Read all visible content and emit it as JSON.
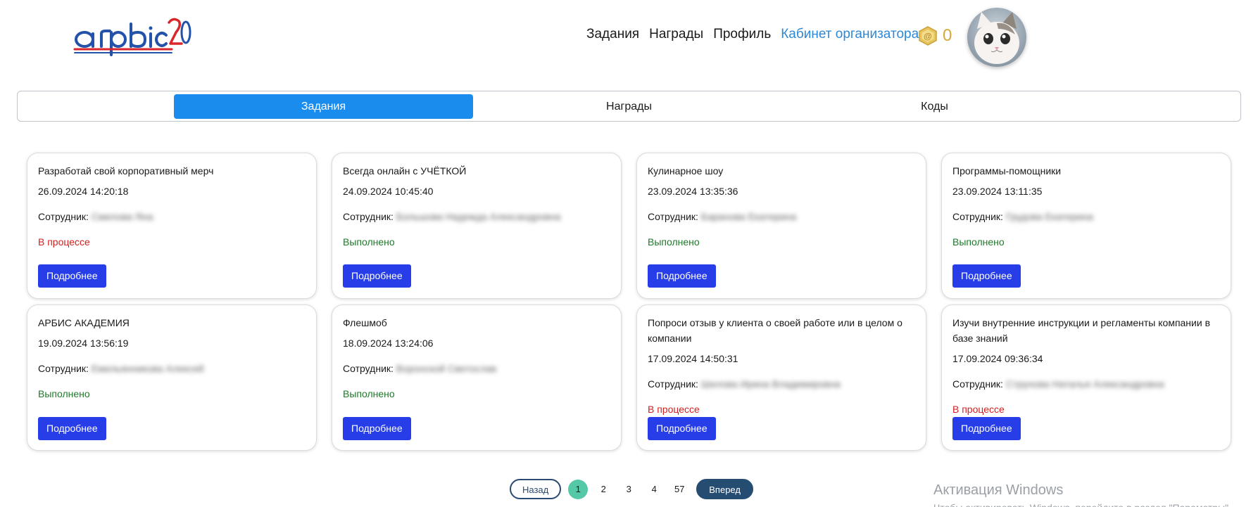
{
  "header": {
    "nav": [
      {
        "label": "Задания",
        "accent": false
      },
      {
        "label": "Награды",
        "accent": false
      },
      {
        "label": "Профиль",
        "accent": false
      },
      {
        "label": "Кабинет организатора",
        "accent": true
      }
    ],
    "coins": "0",
    "colors": {
      "accent": "#2d88d6",
      "coin": "#d5a83b"
    }
  },
  "tabs": [
    {
      "label": "Задания",
      "active": true
    },
    {
      "label": "Награды",
      "active": false
    },
    {
      "label": "Коды",
      "active": false
    }
  ],
  "labels": {
    "employee": "Сотрудник:",
    "more_button": "Подробнее"
  },
  "cards": [
    {
      "title": "Разработай свой корпоративный мерч",
      "date": "26.09.2024 14:20:18",
      "employee": "Смелова Яна",
      "status": "В процессе",
      "state": "progress"
    },
    {
      "title": "Всегда онлайн с УЧЁТКОЙ",
      "date": "24.09.2024 10:45:40",
      "employee": "Большова Надежда Александровна",
      "status": "Выполнено",
      "state": "done"
    },
    {
      "title": "Кулинарное шоу",
      "date": "23.09.2024 13:35:36",
      "employee": "Баранова Екатерина",
      "status": "Выполнено",
      "state": "done"
    },
    {
      "title": "Программы-помощники",
      "date": "23.09.2024 13:11:35",
      "employee": "Грудова Екатерина",
      "status": "Выполнено",
      "state": "done"
    },
    {
      "title": "АРБИС АКАДЕМИЯ",
      "date": "19.09.2024 13:56:19",
      "employee": "Емельянникова Алексей",
      "status": "Выполнено",
      "state": "done"
    },
    {
      "title": "Флешмоб",
      "date": "18.09.2024 13:24:06",
      "employee": "Воронской Светослав",
      "status": "Выполнено",
      "state": "done"
    },
    {
      "title": "Попроси отзыв у клиента о своей работе или в целом о компании",
      "date": "17.09.2024 14:50:31",
      "employee": "Шилова Ирина Владимировна",
      "status": "В процессе",
      "state": "progress"
    },
    {
      "title": "Изучи внутренние инструкции и регламенты компании в базе знаний",
      "date": "17.09.2024 09:36:34",
      "employee": "Струнова Наталья Александровна",
      "status": "В процессе",
      "state": "progress"
    }
  ],
  "pagination": {
    "prev": "Назад",
    "pages": [
      "1",
      "2",
      "3",
      "4",
      "57"
    ],
    "current": "1",
    "next": "Вперед"
  },
  "watermark": {
    "line1": "Активация Windows",
    "line2": "Чтобы активировать Windows, перейдите в раздел \"Параметры\"."
  }
}
